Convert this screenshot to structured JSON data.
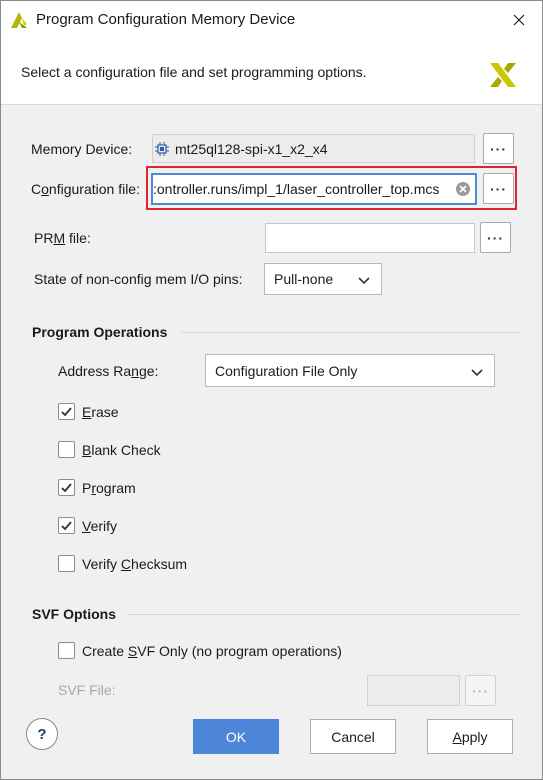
{
  "window": {
    "title": "Program Configuration Memory Device",
    "header_text": "Select a configuration file and set programming options."
  },
  "memory_device": {
    "label": "Memory Device:",
    "value": "mt25ql128-spi-x1_x2_x4"
  },
  "config_file": {
    "label_pre": "C",
    "label_u": "o",
    "label_post": "nfiguration file:",
    "value": ":ontroller.runs/impl_1/laser_controller_top.mcs"
  },
  "prm_file": {
    "label_pre": "PR",
    "label_u": "M",
    "label_post": " file:",
    "value": ""
  },
  "io_pins": {
    "label": "State of non-config mem I/O pins:",
    "value": "Pull-none"
  },
  "program_operations": {
    "title": "Program Operations",
    "address_range_label_pre": "Address Ra",
    "address_range_label_u": "n",
    "address_range_label_post": "ge:",
    "address_range_value": "Configuration File Only",
    "options": [
      {
        "u": "E",
        "rest": "rase",
        "checked": true
      },
      {
        "u": "B",
        "rest": "lank Check",
        "checked": false
      },
      {
        "pre": "P",
        "u": "r",
        "rest": "ogram",
        "checked": true
      },
      {
        "u": "V",
        "rest": "erify",
        "checked": true
      },
      {
        "pre": "Verify ",
        "u": "C",
        "rest": "hecksum",
        "checked": false
      }
    ]
  },
  "svf_options": {
    "title": "SVF Options",
    "create_pre": "Create ",
    "create_u": "S",
    "create_post": "VF Only (no program operations)",
    "create_checked": false,
    "svf_file_label": "SVF File:"
  },
  "buttons": {
    "help": "?",
    "ok": "OK",
    "cancel": "Cancel",
    "apply_u": "A",
    "apply_rest": "pply"
  },
  "colors": {
    "accent": "#4d86d8",
    "highlight": "#e0242c",
    "logo": "#c8c800"
  }
}
